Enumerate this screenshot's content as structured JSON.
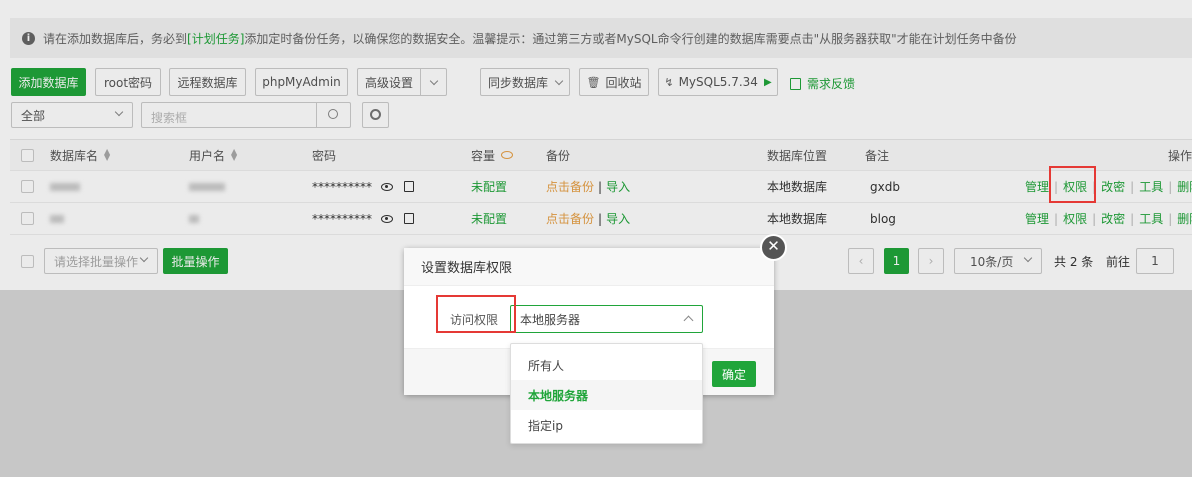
{
  "notice": {
    "text_before": "请在添加数据库后，务必到",
    "link": "[计划任务]",
    "text_after": "添加定时备份任务，以确保您的数据安全。温馨提示：通过第三方或者MySQL命令行创建的数据库需要点击\"从服务器获取\"才能在计划任务中备份"
  },
  "toolbar": {
    "add_db": "添加数据库",
    "root_pwd": "root密码",
    "remote_db": "远程数据库",
    "phpmyadmin": "phpMyAdmin",
    "advanced": "高级设置",
    "sync_db": "同步数据库",
    "recycle": "回收站",
    "mysql": "MySQL5.7.34",
    "feedback": "需求反馈"
  },
  "filter": {
    "category": "全部",
    "search_placeholder": "搜索框"
  },
  "table": {
    "headers": {
      "name": "数据库名",
      "user": "用户名",
      "password": "密码",
      "capacity": "容量",
      "backup": "备份",
      "location": "数据库位置",
      "remark": "备注",
      "ops": "操作"
    },
    "rows": [
      {
        "password": "**********",
        "capacity": "未配置",
        "backup_click": "点击备份",
        "backup_sep": "|",
        "backup_import": "导入",
        "location": "本地数据库",
        "remark": "gxdb",
        "op_manage": "管理",
        "op_perm": "权限",
        "op_pwd": "改密",
        "op_tools": "工具",
        "op_delete": "删除"
      },
      {
        "password": "**********",
        "capacity": "未配置",
        "backup_click": "点击备份",
        "backup_sep": "|",
        "backup_import": "导入",
        "location": "本地数据库",
        "remark": "blog",
        "op_manage": "管理",
        "op_perm": "权限",
        "op_pwd": "改密",
        "op_tools": "工具",
        "op_delete": "删除"
      }
    ]
  },
  "batch": {
    "placeholder": "请选择批量操作",
    "button": "批量操作"
  },
  "pagination": {
    "current": "1",
    "per_page": "10条/页",
    "total": "共 2 条",
    "goto_label": "前往",
    "goto_value": "1"
  },
  "modal": {
    "title": "设置数据库权限",
    "field_label": "访问权限",
    "field_value": "本地服务器",
    "confirm": "确定",
    "close_glyph": "✕",
    "options": [
      "所有人",
      "本地服务器",
      "指定ip"
    ],
    "selected_index": 1
  },
  "colors": {
    "accent": "#20a53a",
    "warning": "#e8a045",
    "highlight": "#e53935"
  }
}
